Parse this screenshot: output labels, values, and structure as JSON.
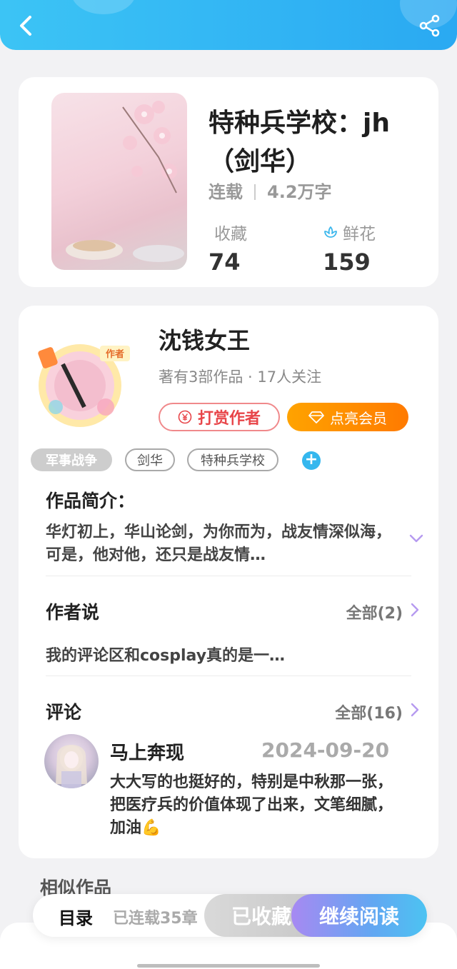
{
  "colors": {
    "accent_blue": "#2aa9f2",
    "vip_orange": "#ff8a00",
    "reward_red": "#e8464a",
    "read_purple": "#a789f2"
  },
  "topbar": {
    "back_icon": "chevron-left-icon",
    "share_icon": "share-icon"
  },
  "book": {
    "title": "特种兵学校：jh（剑华）",
    "status": "连载",
    "word_count": "4.2万字",
    "favorites_label": "收藏",
    "favorites_count": "74",
    "flowers_label": "鲜花",
    "flowers_count": "159",
    "flower_icon": "flower-icon"
  },
  "author": {
    "name": "沈钱女王",
    "info": "著有3部作品 · 17人关注",
    "reward_label": "打赏作者",
    "vip_label": "点亮会员",
    "badge_text": "作者"
  },
  "tags": [
    "军事战争",
    "剑华",
    "特种兵学校"
  ],
  "intro": {
    "title": "作品简介：",
    "text": "华灯初上，华山论剑，为你而为，战友情深似海，可是，他对他，还只是战友情…"
  },
  "author_says": {
    "title": "作者说",
    "more": "全部(2)",
    "text": "我的评论区和cosplay真的是一…"
  },
  "comments": {
    "title": "评论",
    "more": "全部(16)",
    "items": [
      {
        "user": "马上奔现",
        "date": "2024-09-20",
        "text": "大大写的也挺好的，特别是中秋那一张，把医疗兵的价值体现了出来，文笔细腻，加油💪"
      }
    ]
  },
  "similar": {
    "title": "相似作品"
  },
  "bottom_bar": {
    "toc": "目录",
    "chapters": "已连载35章",
    "collected": "已收藏",
    "read": "继续阅读"
  }
}
